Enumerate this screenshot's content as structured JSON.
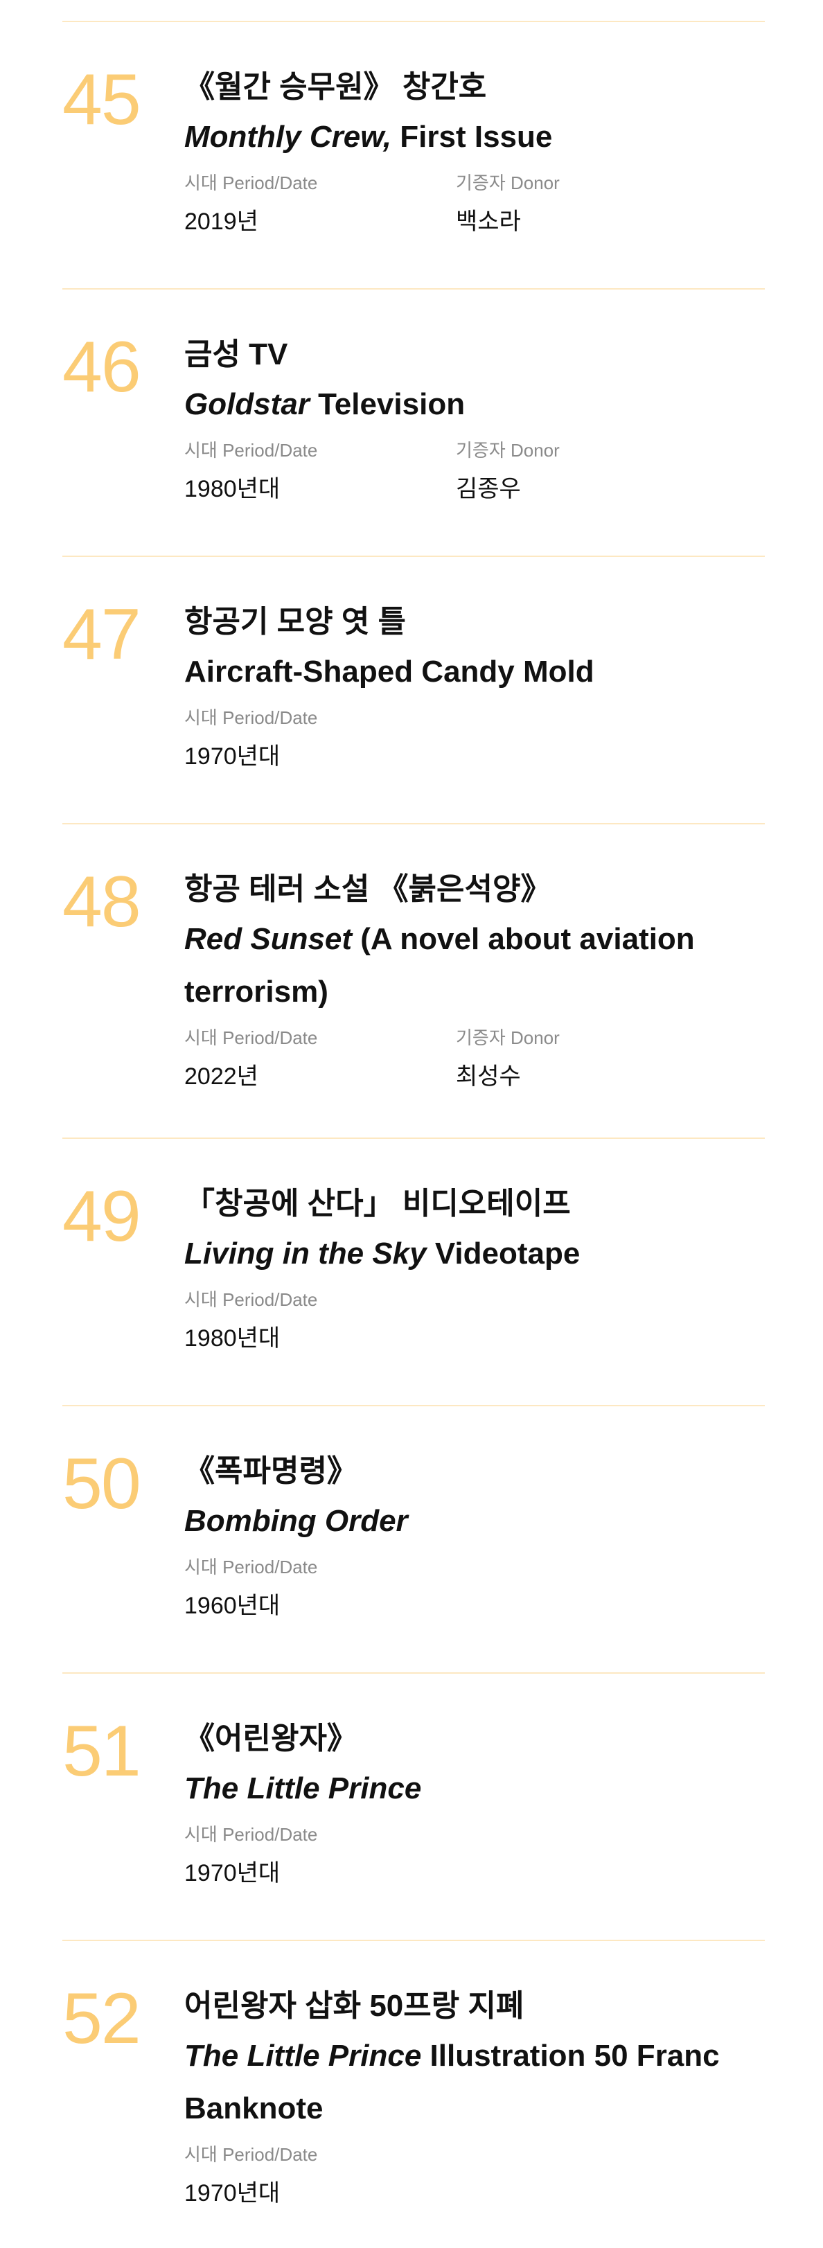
{
  "labels": {
    "period": "시대 Period/Date",
    "donor": "기증자 Donor"
  },
  "items": [
    {
      "number": "45",
      "title_ko": "《월간 승무원》 창간호",
      "title_en_italic": "Monthly Crew,",
      "title_en_rest": " First Issue",
      "period": "2019년",
      "donor": "백소라"
    },
    {
      "number": "46",
      "title_ko": "금성 TV",
      "title_en_italic": "Goldstar",
      "title_en_rest": " Television",
      "period": "1980년대",
      "donor": "김종우"
    },
    {
      "number": "47",
      "title_ko": "항공기 모양 엿 틀",
      "title_en_italic": "",
      "title_en_rest": "Aircraft-Shaped Candy Mold",
      "period": "1970년대",
      "donor": ""
    },
    {
      "number": "48",
      "title_ko": "항공 테러 소설 《붉은석양》",
      "title_en_italic": "Red Sunset",
      "title_en_rest": " (A novel about aviation terrorism)",
      "period": "2022년",
      "donor": "최성수"
    },
    {
      "number": "49",
      "title_ko": "「창공에 산다」 비디오테이프",
      "title_en_italic": "Living in the Sky",
      "title_en_rest": " Videotape",
      "period": "1980년대",
      "donor": ""
    },
    {
      "number": "50",
      "title_ko": "《폭파명령》",
      "title_en_italic": "Bombing Order",
      "title_en_rest": "",
      "period": "1960년대",
      "donor": ""
    },
    {
      "number": "51",
      "title_ko": "《어린왕자》",
      "title_en_italic": "The Little Prince",
      "title_en_rest": "",
      "period": "1970년대",
      "donor": ""
    },
    {
      "number": "52",
      "title_ko": "어린왕자 삽화 50프랑 지폐",
      "title_en_italic": "The Little Prince",
      "title_en_rest": " Illustration 50 Franc Banknote",
      "period": "1970년대",
      "donor": ""
    }
  ]
}
